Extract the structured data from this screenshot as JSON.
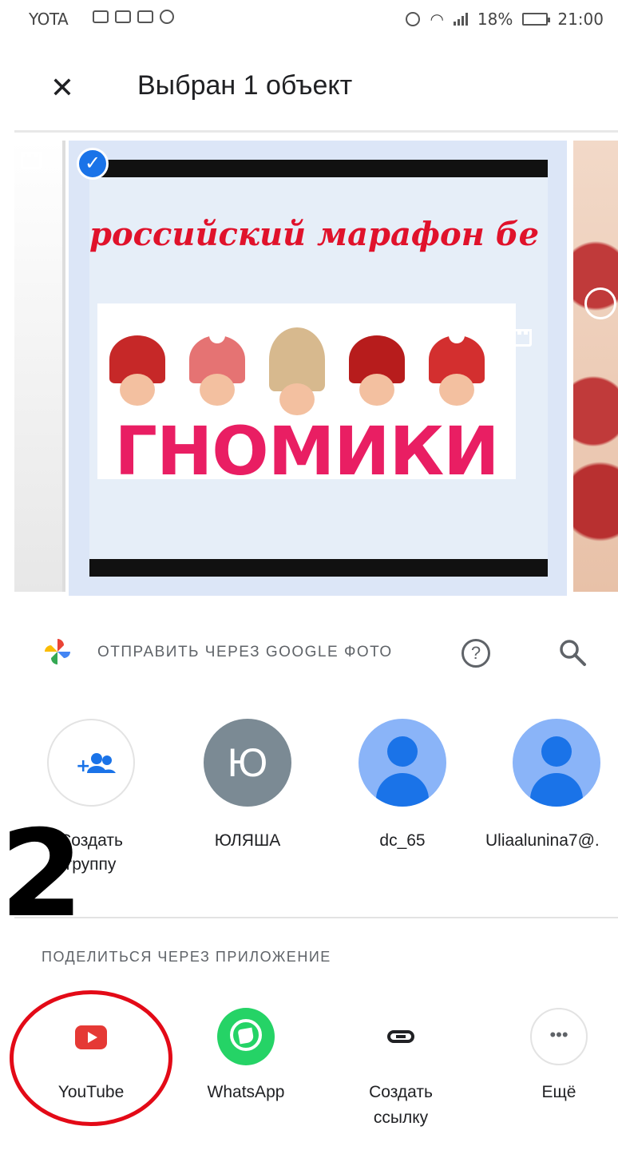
{
  "status_bar": {
    "carrier": "YOTA",
    "battery_percent": "18%",
    "time": "21:00"
  },
  "app_bar": {
    "title": "Выбран 1 объект"
  },
  "gallery": {
    "video_headline": "российский марафон бе",
    "video_title_word": "ГНОМИКИ"
  },
  "google_photos": {
    "send_label": "ОТПРАВИТЬ ЧЕРЕЗ GOOGLE ФОТО",
    "help_glyph": "?"
  },
  "contacts": [
    {
      "label": "Создать группу",
      "avatar": "add-group-icon"
    },
    {
      "label": "ЮЛЯША",
      "initial": "Ю"
    },
    {
      "label": "dc_65",
      "avatar": "person-icon"
    },
    {
      "label": "Uliaalunina7@.",
      "avatar": "person-icon"
    }
  ],
  "share_apps": {
    "section_label": "ПОДЕЛИТЬСЯ ЧЕРЕЗ ПРИЛОЖЕНИЕ",
    "apps": [
      {
        "label": "YouTube",
        "icon": "youtube-icon"
      },
      {
        "label": "WhatsApp",
        "icon": "whatsapp-icon"
      },
      {
        "label": "Создать ссылку",
        "icon": "link-icon"
      },
      {
        "label": "Ещё",
        "icon": "more-icon",
        "glyph": "•••"
      }
    ]
  },
  "annotation_mark": "2",
  "colors": {
    "accent": "#1a73e8",
    "youtube": "#e53935",
    "whatsapp": "#25d366",
    "highlight": "#e30a17"
  }
}
